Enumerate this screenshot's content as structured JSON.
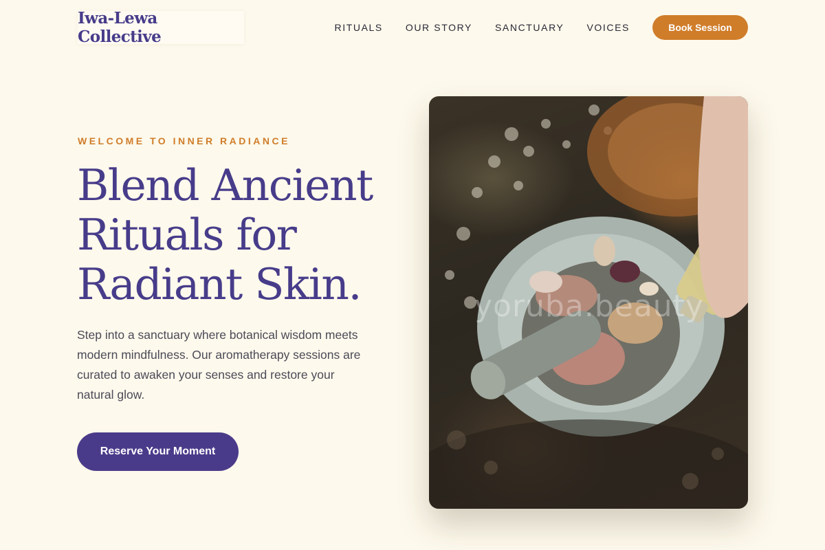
{
  "header": {
    "brand": "Iwa-Lewa Collective",
    "nav": [
      {
        "label": "RITUALS"
      },
      {
        "label": "OUR STORY"
      },
      {
        "label": "SANCTUARY"
      },
      {
        "label": "VOICES"
      }
    ],
    "cta_label": "Book Session"
  },
  "hero": {
    "eyebrow": "WELCOME TO INNER RADIANCE",
    "headline_lines": [
      "Blend Ancient",
      "Rituals for",
      "Radiant Skin."
    ],
    "lead": "Step into a sanctuary where botanical wisdom meets modern mindfulness. Our aromatherapy sessions are curated to awaken your senses and restore your natural glow.",
    "cta_label": "Reserve Your Moment",
    "image": {
      "subject": "mortar-and-pestle-with-botanicals",
      "watermark": "yoruba.beauty"
    }
  },
  "colors": {
    "background": "#fdf9ec",
    "brand_purple": "#473c8a",
    "accent_orange": "#d07d2a",
    "cta_purple": "#4a3b8a",
    "body_text": "#4b4a57"
  }
}
